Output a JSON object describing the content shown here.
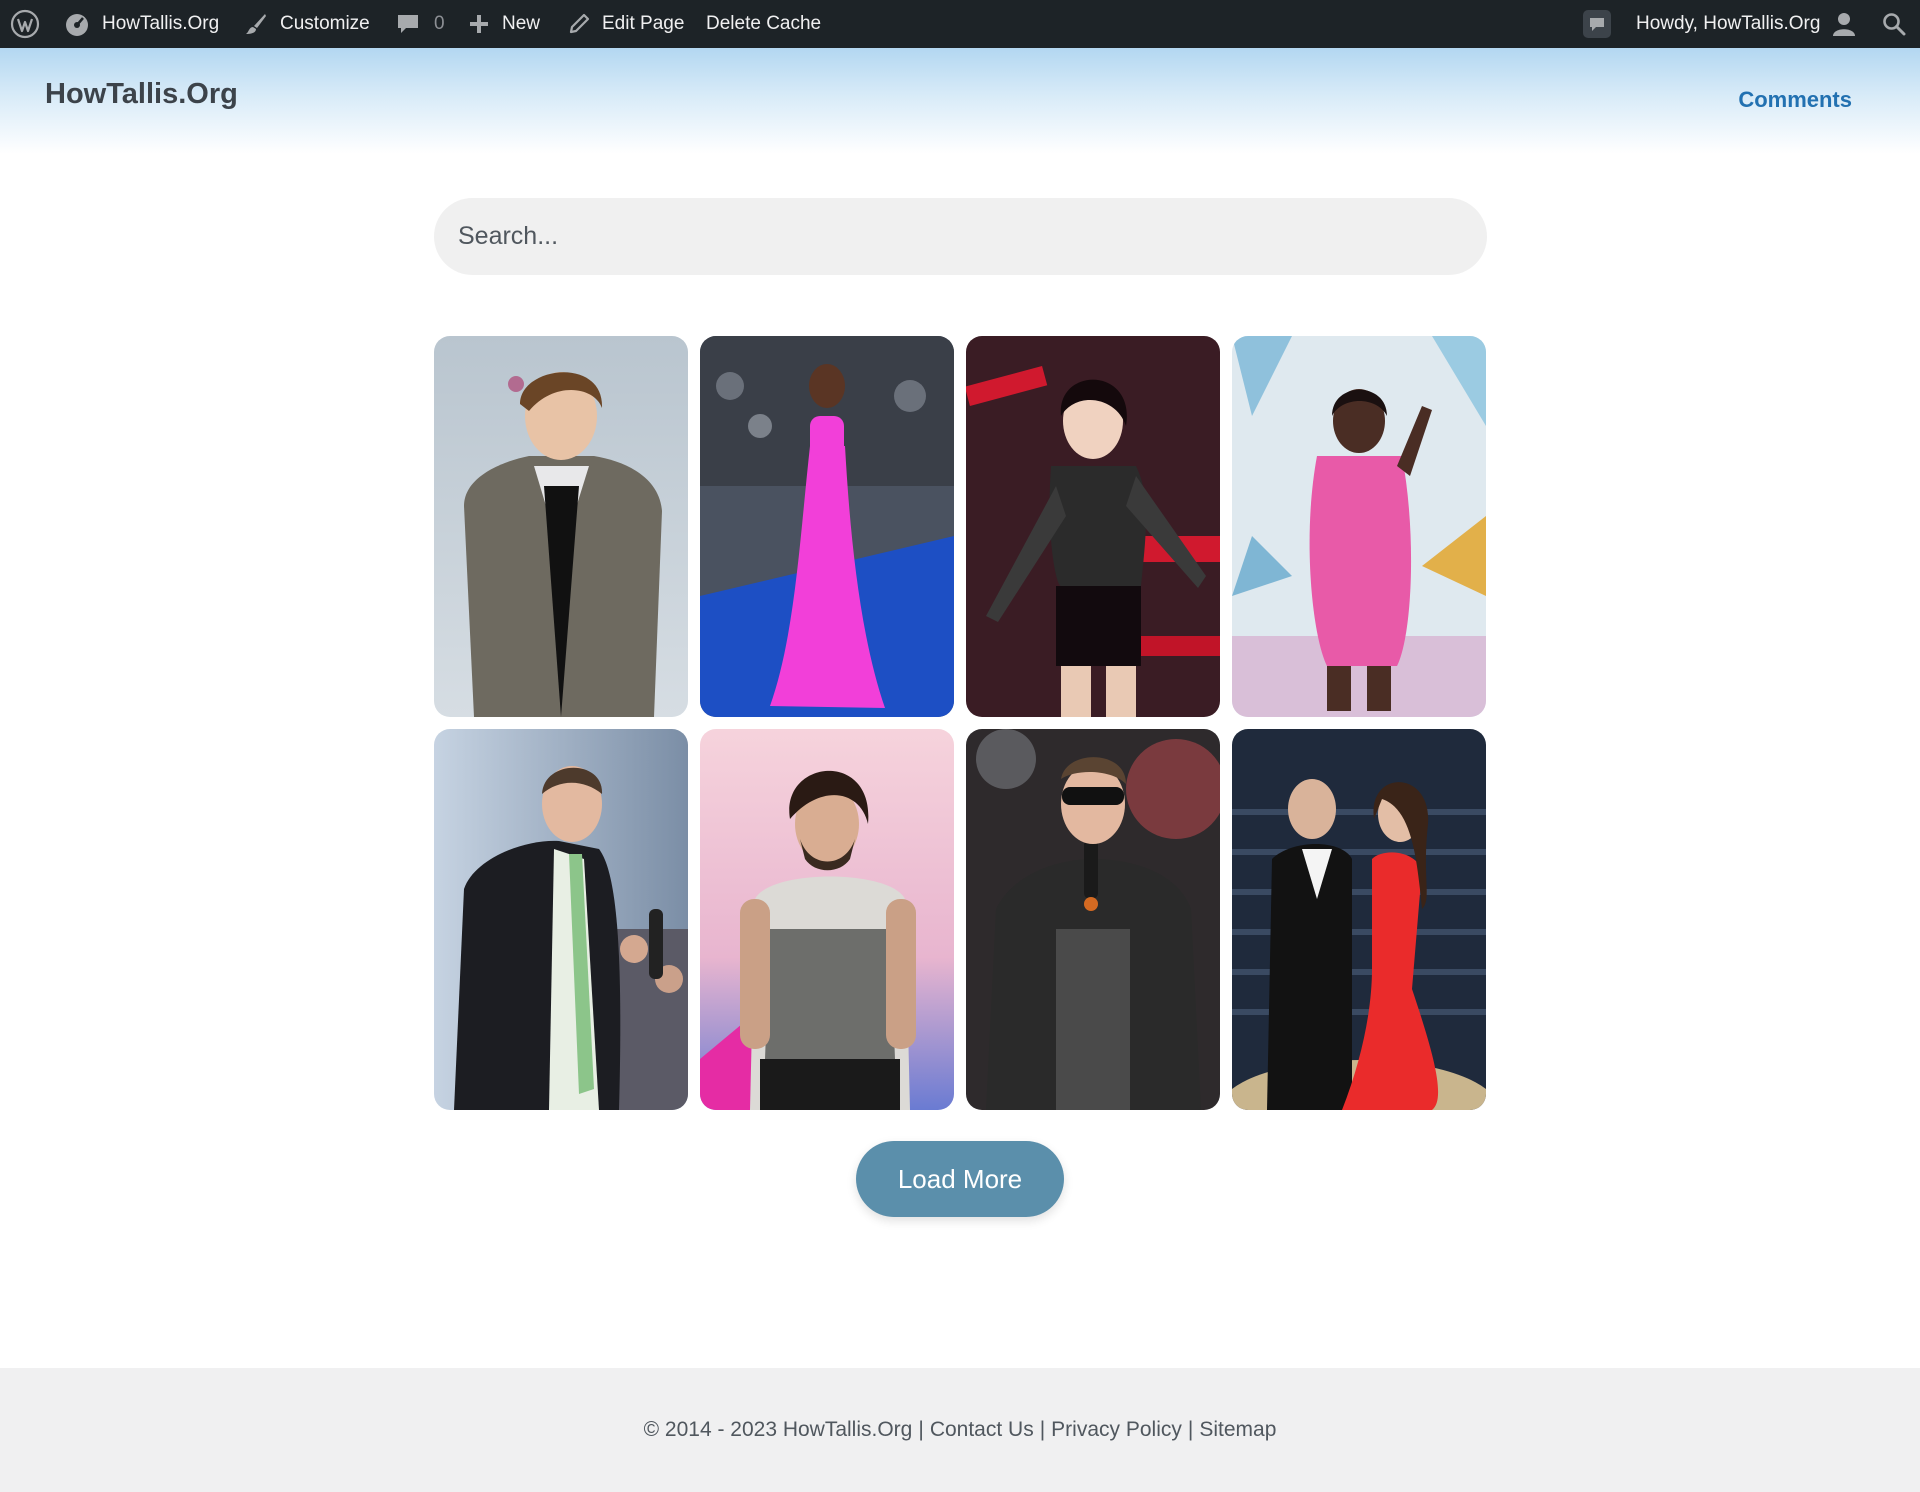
{
  "admin_bar": {
    "site_name": "HowTallis.Org",
    "customize": "Customize",
    "comments_count": "0",
    "new": "New",
    "edit_page": "Edit Page",
    "delete_cache": "Delete Cache",
    "howdy": "Howdy, HowTallis.Org",
    "icons": [
      "wordpress-logo-icon",
      "dashboard-icon",
      "brush-icon",
      "comment-bubble-icon",
      "plus-icon",
      "pencil-icon",
      "notification-icon",
      "user-avatar-icon",
      "search-icon"
    ]
  },
  "header": {
    "site_title": "HowTallis.Org",
    "nav": {
      "comments": "Comments"
    }
  },
  "search": {
    "placeholder": "Search..."
  },
  "grid": {
    "items": [
      {
        "image": "young man in grey houndstooth coat with flower in hair"
      },
      {
        "image": "woman in hot pink gown on blue carpet"
      },
      {
        "image": "performer in black lace crop top on stage"
      },
      {
        "image": "woman in pink dress speaking on stage"
      },
      {
        "image": "man in dark suit with green tie holding microphone"
      },
      {
        "image": "man with curly hair in sleeveless grey shirt"
      },
      {
        "image": "man in sunglasses singing into microphone"
      },
      {
        "image": "couple in tuxedo and red gown at event"
      }
    ]
  },
  "load_more": "Load More",
  "footer": {
    "copyright": "© 2014 - 2023 HowTallis.Org",
    "contact": "Contact Us",
    "privacy": "Privacy Policy",
    "sitemap": "Sitemap",
    "separator": "|"
  },
  "colors": {
    "admin_bar": "#1d2327",
    "link": "#2271b1",
    "button": "#5b8fab",
    "footer_bg": "#f0f0f1"
  }
}
